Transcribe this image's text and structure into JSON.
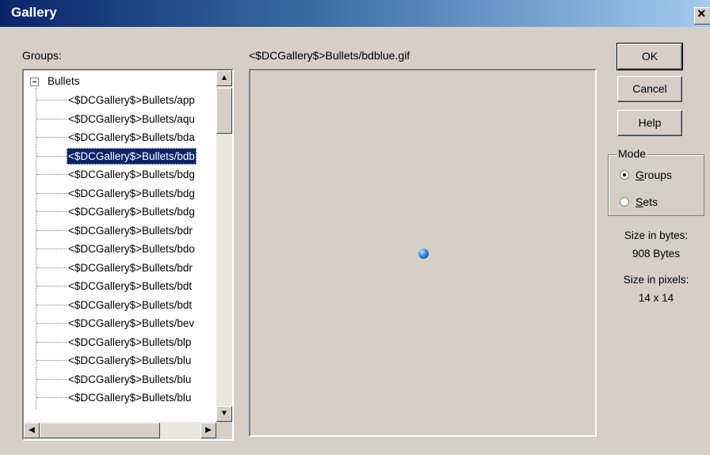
{
  "window": {
    "title": "Gallery",
    "close_glyph": "×"
  },
  "groups_label": "Groups:",
  "preview_path": "<$DCGallery$>Bullets/bdblue.gif",
  "tree": {
    "root_label": "Bullets",
    "expander_icon": "minus-box-icon",
    "items": [
      "<$DCGallery$>Bullets/app",
      "<$DCGallery$>Bullets/aqu",
      "<$DCGallery$>Bullets/bda",
      "<$DCGallery$>Bullets/bdb",
      "<$DCGallery$>Bullets/bdg",
      "<$DCGallery$>Bullets/bdg",
      "<$DCGallery$>Bullets/bdg",
      "<$DCGallery$>Bullets/bdr",
      "<$DCGallery$>Bullets/bdo",
      "<$DCGallery$>Bullets/bdr",
      "<$DCGallery$>Bullets/bdt",
      "<$DCGallery$>Bullets/bdt",
      "<$DCGallery$>Bullets/bev",
      "<$DCGallery$>Bullets/blp",
      "<$DCGallery$>Bullets/blu",
      "<$DCGallery$>Bullets/blu",
      "<$DCGallery$>Bullets/blu",
      "<$DCGallery$>Bullets/blu"
    ],
    "selected_index": 3
  },
  "buttons": {
    "ok": "OK",
    "cancel": "Cancel",
    "help": "Help"
  },
  "mode": {
    "title": "Mode",
    "groups_hotkey": "G",
    "groups_rest": "roups",
    "sets_hotkey": "S",
    "sets_rest": "ets",
    "selected": "Groups"
  },
  "size_bytes": {
    "label": "Size in bytes:",
    "value": "908 Bytes"
  },
  "size_pixels": {
    "label": "Size in pixels:",
    "value": "14 x 14"
  },
  "colors": {
    "titlebar_start": "#0a246a",
    "titlebar_end": "#a6caf0",
    "face": "#d4d0c8",
    "selection": "#0a246a"
  }
}
